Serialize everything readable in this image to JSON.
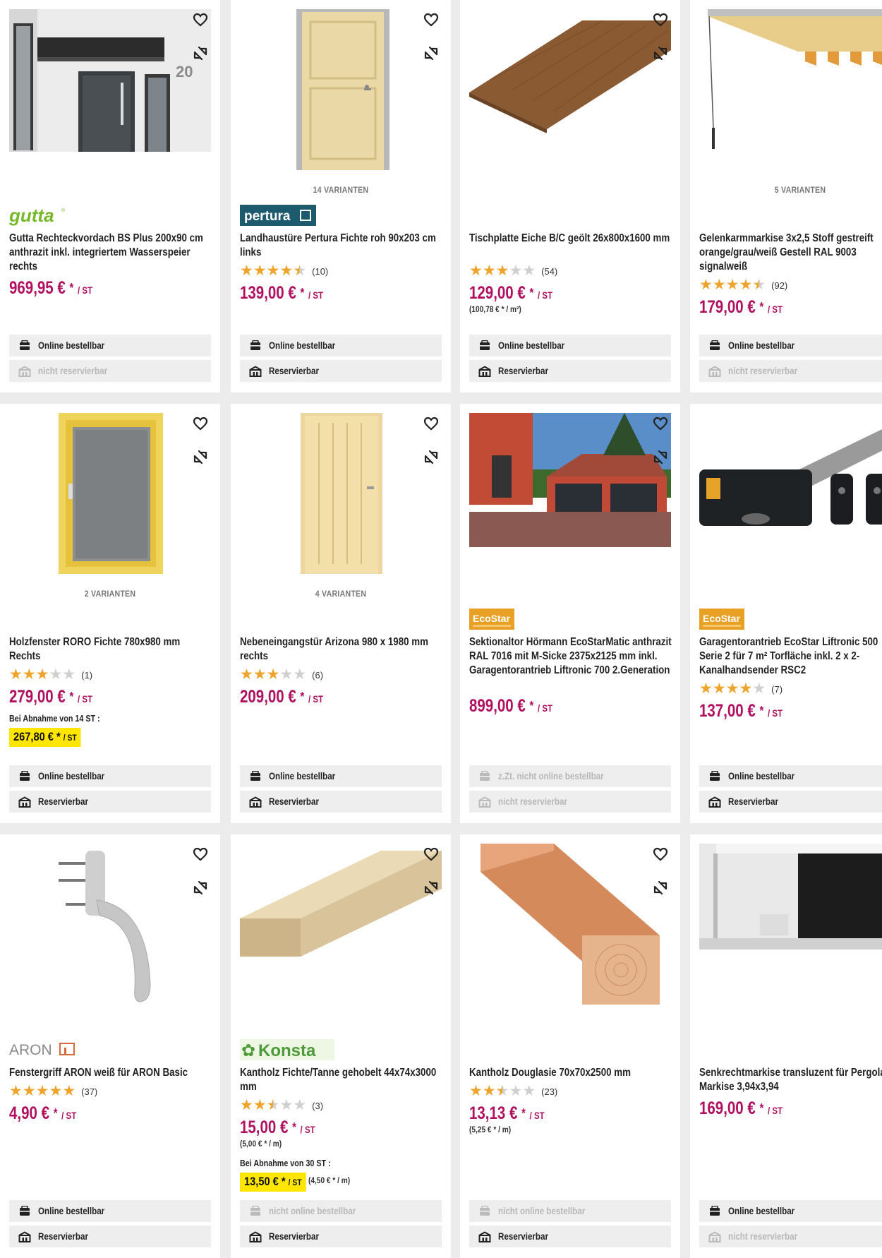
{
  "colors": {
    "price": "#b0105f",
    "bulk_bg": "#ffe600",
    "star": "#f0a32a",
    "star_empty": "#cfcfcf"
  },
  "products": [
    {
      "brand": "gutta",
      "variants": "",
      "title": "Gutta Rechteckvordach BS Plus 200x90 cm anthrazit inkl. integriertem Wasserspeier rechts",
      "rating": null,
      "reviews": "",
      "price": "969,95 €",
      "price_unit": "/ ST",
      "unit_price": "",
      "bulk_label": "",
      "bulk_price": "",
      "bulk_unit": "",
      "bulk_extra": "",
      "online": "Online bestellbar",
      "online_on": true,
      "reserve": "nicht reservierbar",
      "reserve_on": false
    },
    {
      "brand": "pertura",
      "variants": "14 VARIANTEN",
      "title": "Landhaustüre Pertura Fichte roh 90x203 cm links",
      "rating": 4.5,
      "reviews": "(10)",
      "price": "139,00 €",
      "price_unit": "/ ST",
      "unit_price": "",
      "bulk_label": "",
      "bulk_price": "",
      "bulk_unit": "",
      "bulk_extra": "",
      "online": "Online bestellbar",
      "online_on": true,
      "reserve": "Reservierbar",
      "reserve_on": true
    },
    {
      "brand": "",
      "variants": "",
      "title": "Tischplatte Eiche B/C geölt 26x800x1600 mm",
      "rating": 3,
      "reviews": "(54)",
      "price": "129,00 €",
      "price_unit": "/ ST",
      "unit_price": "(100,78 € * / m²)",
      "bulk_label": "",
      "bulk_price": "",
      "bulk_unit": "",
      "bulk_extra": "",
      "online": "Online bestellbar",
      "online_on": true,
      "reserve": "Reservierbar",
      "reserve_on": true
    },
    {
      "brand": "",
      "variants": "5 VARIANTEN",
      "title": "Gelenkarmmarkise 3x2,5 Stoff gestreift orange/grau/weiß Gestell RAL 9003 signalweiß",
      "rating": 4.5,
      "reviews": "(92)",
      "price": "179,00 €",
      "price_unit": "/ ST",
      "unit_price": "",
      "bulk_label": "",
      "bulk_price": "",
      "bulk_unit": "",
      "bulk_extra": "",
      "online": "Online bestellbar",
      "online_on": true,
      "reserve": "nicht reservierbar",
      "reserve_on": false
    },
    {
      "brand": "",
      "variants": "2 VARIANTEN",
      "title": "Holzfenster RORO Fichte 780x980 mm Rechts",
      "rating": 3,
      "reviews": "(1)",
      "price": "279,00 €",
      "price_unit": "/ ST",
      "unit_price": "",
      "bulk_label": "Bei Abnahme von 14 ST :",
      "bulk_price": "267,80 €",
      "bulk_unit": "/ ST",
      "bulk_extra": "",
      "online": "Online bestellbar",
      "online_on": true,
      "reserve": "Reservierbar",
      "reserve_on": true
    },
    {
      "brand": "",
      "variants": "4 VARIANTEN",
      "title": "Nebeneingangstür Arizona 980 x 1980 mm rechts",
      "rating": 3,
      "reviews": "(6)",
      "price": "209,00 €",
      "price_unit": "/ ST",
      "unit_price": "",
      "bulk_label": "",
      "bulk_price": "",
      "bulk_unit": "",
      "bulk_extra": "",
      "online": "Online bestellbar",
      "online_on": true,
      "reserve": "Reservierbar",
      "reserve_on": true
    },
    {
      "brand": "EcoStar",
      "variants": "",
      "title": "Sektionaltor Hörmann EcoStarMatic anthrazit RAL 7016 mit M-Sicke 2375x2125 mm inkl. Garagentorantrieb Liftronic 700 2.Generation",
      "rating": null,
      "reviews": "",
      "price": "899,00 €",
      "price_unit": "/ ST",
      "unit_price": "",
      "bulk_label": "",
      "bulk_price": "",
      "bulk_unit": "",
      "bulk_extra": "",
      "online": "z.Zt. nicht online bestellbar",
      "online_on": false,
      "reserve": "nicht reservierbar",
      "reserve_on": false
    },
    {
      "brand": "EcoStar",
      "variants": "",
      "title": "Garagentorantrieb EcoStar Liftronic 500 Serie 2 für 7 m² Torfläche inkl. 2 x 2-Kanalhandsender RSC2",
      "rating": 4,
      "reviews": "(7)",
      "price": "137,00 €",
      "price_unit": "/ ST",
      "unit_price": "",
      "bulk_label": "",
      "bulk_price": "",
      "bulk_unit": "",
      "bulk_extra": "",
      "online": "Online bestellbar",
      "online_on": true,
      "reserve": "Reservierbar",
      "reserve_on": true
    },
    {
      "brand": "ARON",
      "variants": "",
      "title": "Fenstergriff ARON weiß für ARON Basic",
      "rating": 5,
      "reviews": "(37)",
      "price": "4,90 €",
      "price_unit": "/ ST",
      "unit_price": "",
      "bulk_label": "",
      "bulk_price": "",
      "bulk_unit": "",
      "bulk_extra": "",
      "online": "Online bestellbar",
      "online_on": true,
      "reserve": "Reservierbar",
      "reserve_on": true
    },
    {
      "brand": "Konsta",
      "variants": "",
      "title": "Kantholz Fichte/Tanne gehobelt 44x74x3000 mm",
      "rating": 2.5,
      "reviews": "(3)",
      "price": "15,00 €",
      "price_unit": "/ ST",
      "unit_price": "(5,00 € * / m)",
      "bulk_label": "Bei Abnahme von 30 ST :",
      "bulk_price": "13,50 €",
      "bulk_unit": "/ ST",
      "bulk_extra": "(4,50 € * / m)",
      "online": "nicht online bestellbar",
      "online_on": false,
      "reserve": "Reservierbar",
      "reserve_on": true
    },
    {
      "brand": "",
      "variants": "",
      "title": "Kantholz Douglasie 70x70x2500 mm",
      "rating": 2.5,
      "reviews": "(23)",
      "price": "13,13 €",
      "price_unit": "/ ST",
      "unit_price": "(5,25 € * / m)",
      "bulk_label": "",
      "bulk_price": "",
      "bulk_unit": "",
      "bulk_extra": "",
      "online": "nicht online bestellbar",
      "online_on": false,
      "reserve": "Reservierbar",
      "reserve_on": true
    },
    {
      "brand": "",
      "variants": "",
      "title": "Senkrechtmarkise transluzent für Pergola Markise 3,94x3,94",
      "rating": null,
      "reviews": "",
      "price": "169,00 €",
      "price_unit": "/ ST",
      "unit_price": "",
      "bulk_label": "",
      "bulk_price": "",
      "bulk_unit": "",
      "bulk_extra": "",
      "online": "Online bestellbar",
      "online_on": true,
      "reserve": "nicht reservierbar",
      "reserve_on": false
    }
  ]
}
